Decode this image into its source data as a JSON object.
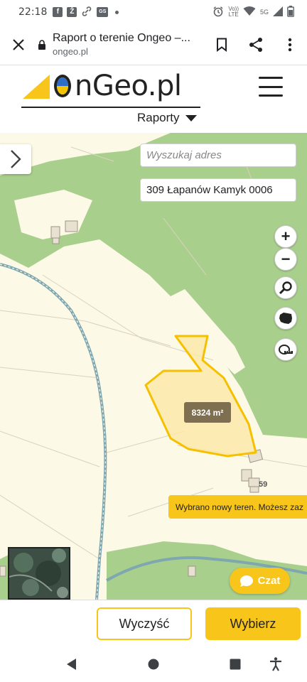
{
  "status_bar": {
    "time": "22:18",
    "notification_icons": [
      "facebook-icon",
      "zoznam-icon",
      "link-icon",
      "gs-icon"
    ],
    "network_label_top": "Vo))",
    "network_label_bottom": "LTE",
    "network_5g": "5G"
  },
  "browser": {
    "page_title": "Raport o terenie Ongeo –...",
    "url": "ongeo.pl"
  },
  "header": {
    "logo_text": "nGeo.pl",
    "reports_label": "Raporty"
  },
  "map": {
    "search_placeholder": "Wyszukaj adres",
    "address_value": "309 Łapanów Kamyk 0006",
    "zoom_in": "+",
    "zoom_out": "−",
    "area_label": "8324 m²",
    "house_number": "59",
    "toast_message": "Wybrano nowy teren. Możesz zaz",
    "chat_label": "Czat"
  },
  "actions": {
    "clear_label": "Wyczyść",
    "select_label": "Wybierz"
  },
  "colors": {
    "accent": "#f8c51a",
    "forest": "#a9cf8c",
    "map_background": "#fdf9e7",
    "parcel_fill": "#fbe9a8",
    "parcel_stroke": "#f5c000"
  }
}
